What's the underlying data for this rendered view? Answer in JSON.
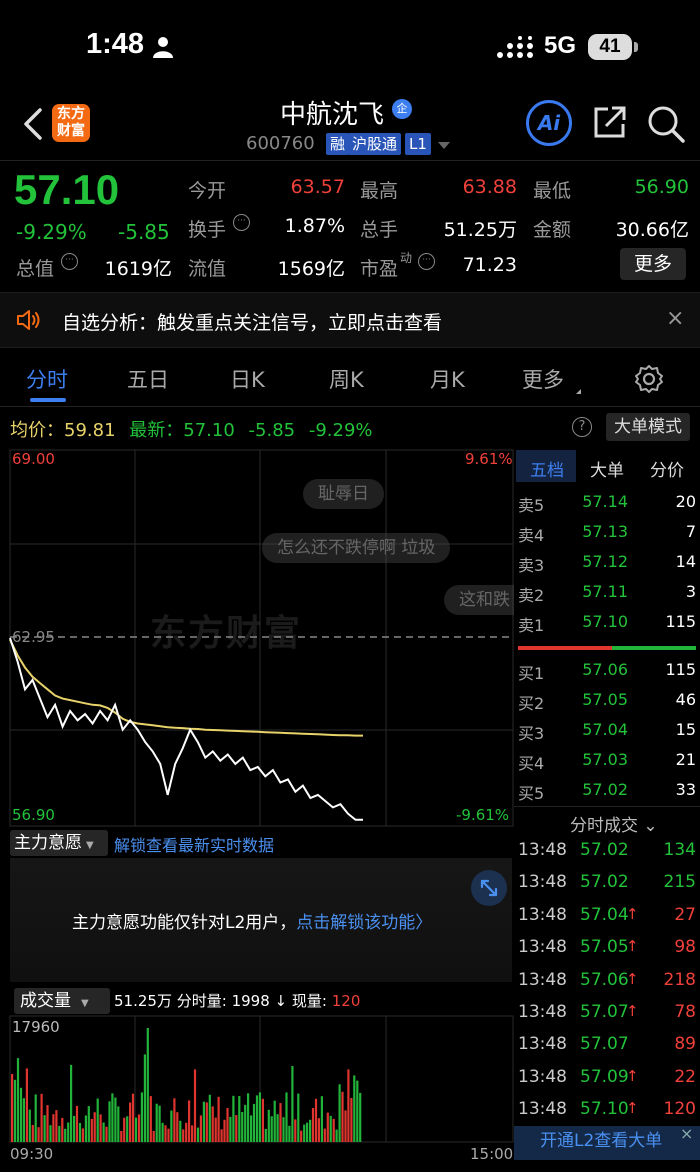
{
  "status_bar": {
    "time": "1:48",
    "network": "5G",
    "battery": "41"
  },
  "header": {
    "stock_name": "中航沈飞",
    "enterprise_badge": "企",
    "stock_code": "600760",
    "tags": [
      "融",
      "沪股通",
      "L1"
    ],
    "logo_line1": "东方",
    "logo_line2": "财富",
    "ai_label": "Ai"
  },
  "quote": {
    "last_price": "57.10",
    "change_pct": "-9.29%",
    "change_value": "-5.85",
    "fields": {
      "open_label": "今开",
      "open": "63.57",
      "high_label": "最高",
      "high": "63.88",
      "low_label": "最低",
      "low": "56.90",
      "turnover_label": "换手",
      "turnover": "1.87%",
      "volume_label": "总手",
      "volume": "51.25万",
      "amount_label": "金额",
      "amount": "30.66亿",
      "mktcap_label": "总值",
      "mktcap": "1619亿",
      "float_label": "流值",
      "float_cap": "1569亿",
      "pe_label": "市盈",
      "pe_sup": "动",
      "pe": "71.23"
    },
    "more_label": "更多"
  },
  "banner": {
    "text": "自选分析：触发重点关注信号，立即点击查看",
    "close": "×"
  },
  "tabs": [
    {
      "label": "分时",
      "active": true
    },
    {
      "label": "五日"
    },
    {
      "label": "日K"
    },
    {
      "label": "周K"
    },
    {
      "label": "月K"
    },
    {
      "label": "更多"
    }
  ],
  "avg_row": {
    "avg_label": "均价：",
    "avg_value": "59.81",
    "last_label": "最新：",
    "last_value": "57.10",
    "change": "-5.85",
    "pct": "-9.29%",
    "help": "?",
    "big_order_mode": "大单模式"
  },
  "intraday": {
    "y_top": "69.00",
    "y_bottom": "56.90",
    "prev_close": "62.95",
    "pct_top": "9.61%",
    "pct_bottom": "-9.61%",
    "watermark": "东方财富",
    "bullets": [
      "耻辱日",
      "怎么还不跌停啊 垃圾",
      "这和跌"
    ],
    "price_line_color": "#ffffff",
    "avg_line_color": "#e8d36b"
  },
  "chart_data": {
    "type": "line",
    "x": [
      0,
      5,
      10,
      15,
      20,
      25,
      30,
      35,
      40,
      45,
      50,
      55,
      60,
      65,
      70,
      75,
      80,
      85,
      90,
      95,
      100,
      105,
      110,
      115,
      120,
      125,
      130,
      135,
      140,
      145,
      150,
      155,
      160,
      165,
      170,
      175,
      180,
      185,
      190,
      195,
      200,
      205,
      210,
      215,
      220,
      225,
      230,
      235
    ],
    "xlabel": "",
    "ylabel": "",
    "ylim": [
      56.9,
      69.0
    ],
    "x_ticks": [
      "09:30",
      "15:00"
    ],
    "series": [
      {
        "values": [
          62.95,
          62.2,
          61.3,
          61.6,
          61.0,
          60.4,
          60.8,
          60.1,
          60.6,
          60.3,
          60.5,
          60.2,
          60.6,
          60.3,
          60.8,
          60.0,
          60.3,
          60.0,
          59.6,
          59.3,
          58.9,
          57.9,
          58.9,
          59.4,
          60.0,
          59.6,
          59.1,
          59.3,
          59.0,
          59.2,
          58.9,
          59.1,
          58.7,
          58.8,
          58.5,
          58.7,
          58.3,
          58.4,
          58.0,
          58.2,
          57.8,
          57.9,
          57.7,
          57.5,
          57.6,
          57.3,
          57.1,
          57.1
        ]
      },
      {
        "values": [
          62.9,
          62.4,
          62.0,
          61.7,
          61.5,
          61.3,
          61.1,
          61.0,
          60.95,
          60.9,
          60.85,
          60.8,
          60.78,
          60.7,
          60.55,
          60.35,
          60.25,
          60.2,
          60.17,
          60.14,
          60.11,
          60.08,
          60.06,
          60.05,
          60.03,
          60.02,
          60.0,
          59.99,
          59.98,
          59.97,
          59.96,
          59.95,
          59.94,
          59.93,
          59.92,
          59.91,
          59.9,
          59.89,
          59.88,
          59.87,
          59.86,
          59.85,
          59.84,
          59.83,
          59.82,
          59.82,
          59.81,
          59.81
        ]
      }
    ]
  },
  "orderbook": {
    "tabs": [
      "五档",
      "大单",
      "分价"
    ],
    "asks": [
      {
        "label": "卖5",
        "price": "57.14",
        "vol": "20"
      },
      {
        "label": "卖4",
        "price": "57.13",
        "vol": "7"
      },
      {
        "label": "卖3",
        "price": "57.12",
        "vol": "14"
      },
      {
        "label": "卖2",
        "price": "57.11",
        "vol": "3"
      },
      {
        "label": "卖1",
        "price": "57.10",
        "vol": "115"
      }
    ],
    "bids": [
      {
        "label": "买1",
        "price": "57.06",
        "vol": "115"
      },
      {
        "label": "买2",
        "price": "57.05",
        "vol": "46"
      },
      {
        "label": "买3",
        "price": "57.04",
        "vol": "15"
      },
      {
        "label": "买4",
        "price": "57.03",
        "vol": "21"
      },
      {
        "label": "买5",
        "price": "57.02",
        "vol": "33"
      }
    ],
    "tick_title": "分时成交 ⌄",
    "ticks": [
      {
        "time": "13:48",
        "price": "57.02",
        "arrow": "",
        "vol": "134",
        "color": "#22c23a"
      },
      {
        "time": "13:48",
        "price": "57.02",
        "arrow": "",
        "vol": "215",
        "color": "#22c23a"
      },
      {
        "time": "13:48",
        "price": "57.04",
        "arrow": "↑",
        "vol": "27",
        "color": "#f0403a"
      },
      {
        "time": "13:48",
        "price": "57.05",
        "arrow": "↑",
        "vol": "98",
        "color": "#f0403a"
      },
      {
        "time": "13:48",
        "price": "57.06",
        "arrow": "↑",
        "vol": "218",
        "color": "#f0403a"
      },
      {
        "time": "13:48",
        "price": "57.07",
        "arrow": "↑",
        "vol": "78",
        "color": "#f0403a"
      },
      {
        "time": "13:48",
        "price": "57.07",
        "arrow": "",
        "vol": "89",
        "color": "#f0403a"
      },
      {
        "time": "13:48",
        "price": "57.09",
        "arrow": "↑",
        "vol": "22",
        "color": "#f0403a"
      },
      {
        "time": "13:48",
        "price": "57.10",
        "arrow": "↑",
        "vol": "120",
        "color": "#f0403a"
      }
    ],
    "l2_banner": "开通L2查看大单",
    "l2_close": "×"
  },
  "main_force": {
    "dropdown": "主力意愿",
    "unlock_link": "解锁查看最新实时数据",
    "notice": "主力意愿功能仅针对L2用户，",
    "notice_link": "点击解锁该功能〉"
  },
  "volume": {
    "dropdown": "成交量",
    "total": "51.25万",
    "tick_label": "分时量:",
    "tick_value": "1998",
    "now_label": "现量:",
    "now_value": "120",
    "max_label": "17960",
    "time_start": "09:30",
    "time_end": "15:00"
  }
}
